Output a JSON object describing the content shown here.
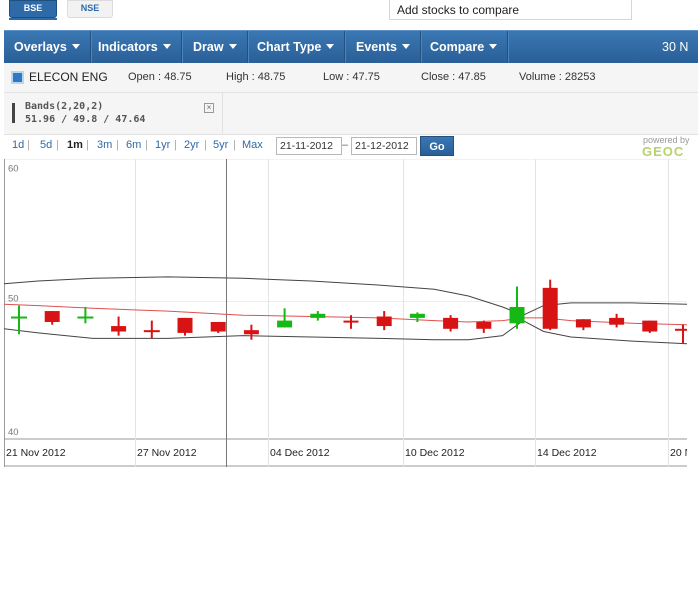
{
  "exchange_tabs": [
    "BSE",
    "NSE"
  ],
  "compare_search": {
    "placeholder": "Add stocks to compare"
  },
  "menu": {
    "items": [
      "Overlays",
      "Indicators",
      "Draw",
      "Chart Type",
      "Events",
      "Compare"
    ],
    "date_partial": "30 N"
  },
  "quote": {
    "name": "ELECON ENG",
    "open_label": "Open : 48.75",
    "high_label": "High : 48.75",
    "low_label": "Low : 47.75",
    "close_label": "Close : 47.85",
    "volume_label": "Volume : 28253"
  },
  "indicator": {
    "name": "Bands(2,20,2)",
    "values": "51.96 / 49.8 / 47.64",
    "close_symbol": "×"
  },
  "range": {
    "links": [
      "1d",
      "5d",
      "1m",
      "3m",
      "6m",
      "1yr",
      "2yr",
      "5yr",
      "Max"
    ],
    "active": "1m",
    "from_date": "21-11-2012",
    "to_date": "21-12-2012",
    "go_label": "Go",
    "powered_by": "powered by",
    "powered_logo": "GEOC"
  },
  "colors": {
    "accent": "#2e6aa8",
    "up": "#16b814",
    "down": "#d71313",
    "middle_band": "#e05050",
    "outer_band": "#444444"
  },
  "chart_data": {
    "type": "candlestick",
    "ylim": [
      40,
      60
    ],
    "yticks": [
      60,
      50,
      40
    ],
    "x_labels": [
      "21 Nov 2012",
      "27 Nov 2012",
      "04 Dec 2012",
      "10 Dec 2012",
      "14 Dec 2012",
      "20 N"
    ],
    "candles": [
      {
        "o": 48.9,
        "h": 49.7,
        "l": 47.6,
        "c": 48.9,
        "dir": "up"
      },
      {
        "o": 49.3,
        "h": 49.3,
        "l": 48.3,
        "c": 48.5,
        "dir": "down"
      },
      {
        "o": 48.9,
        "h": 49.6,
        "l": 48.4,
        "c": 48.9,
        "dir": "up"
      },
      {
        "o": 48.2,
        "h": 48.9,
        "l": 47.5,
        "c": 47.8,
        "dir": "down"
      },
      {
        "o": 47.9,
        "h": 48.6,
        "l": 47.3,
        "c": 47.9,
        "dir": "down"
      },
      {
        "o": 48.8,
        "h": 48.8,
        "l": 47.5,
        "c": 47.7,
        "dir": "down"
      },
      {
        "o": 48.5,
        "h": 48.5,
        "l": 47.7,
        "c": 47.8,
        "dir": "down"
      },
      {
        "o": 47.9,
        "h": 48.3,
        "l": 47.2,
        "c": 47.6,
        "dir": "down"
      },
      {
        "o": 48.1,
        "h": 49.5,
        "l": 48.1,
        "c": 48.6,
        "dir": "up"
      },
      {
        "o": 48.8,
        "h": 49.3,
        "l": 48.6,
        "c": 49.1,
        "dir": "up"
      },
      {
        "o": 48.6,
        "h": 49.0,
        "l": 48.0,
        "c": 48.5,
        "dir": "down"
      },
      {
        "o": 48.9,
        "h": 49.3,
        "l": 47.9,
        "c": 48.2,
        "dir": "down"
      },
      {
        "o": 48.8,
        "h": 49.2,
        "l": 48.5,
        "c": 49.1,
        "dir": "up"
      },
      {
        "o": 48.8,
        "h": 49.0,
        "l": 47.8,
        "c": 48.0,
        "dir": "down"
      },
      {
        "o": 48.5,
        "h": 48.6,
        "l": 47.7,
        "c": 48.0,
        "dir": "down"
      },
      {
        "o": 48.4,
        "h": 51.1,
        "l": 48.0,
        "c": 49.6,
        "dir": "up"
      },
      {
        "o": 51.0,
        "h": 51.6,
        "l": 47.9,
        "c": 48.0,
        "dir": "down"
      },
      {
        "o": 48.7,
        "h": 48.7,
        "l": 47.9,
        "c": 48.1,
        "dir": "down"
      },
      {
        "o": 48.8,
        "h": 49.1,
        "l": 48.1,
        "c": 48.3,
        "dir": "down"
      },
      {
        "o": 48.6,
        "h": 48.6,
        "l": 47.7,
        "c": 47.8,
        "dir": "down"
      },
      {
        "o": 48.0,
        "h": 48.3,
        "l": 46.9,
        "c": 48.0,
        "dir": "down"
      }
    ],
    "bands": {
      "upper_x": [
        0,
        0.05,
        0.13,
        0.24,
        0.35,
        0.45,
        0.55,
        0.63,
        0.68,
        0.73,
        0.76,
        0.79,
        0.83,
        0.92,
        1.0
      ],
      "upper": [
        51.3,
        51.5,
        51.7,
        51.8,
        51.7,
        51.5,
        51.2,
        50.9,
        50.4,
        49.6,
        49.0,
        49.7,
        49.9,
        49.9,
        49.8
      ],
      "middle": [
        49.8,
        49.7,
        49.5,
        49.3,
        49.0,
        48.9,
        48.8,
        48.6,
        48.5,
        48.6,
        48.8,
        48.8,
        48.6,
        48.4,
        48.3
      ],
      "lower": [
        48.0,
        47.7,
        47.3,
        47.3,
        47.5,
        47.4,
        47.3,
        47.2,
        47.2,
        47.5,
        48.6,
        47.8,
        47.4,
        47.1,
        46.9
      ]
    }
  }
}
